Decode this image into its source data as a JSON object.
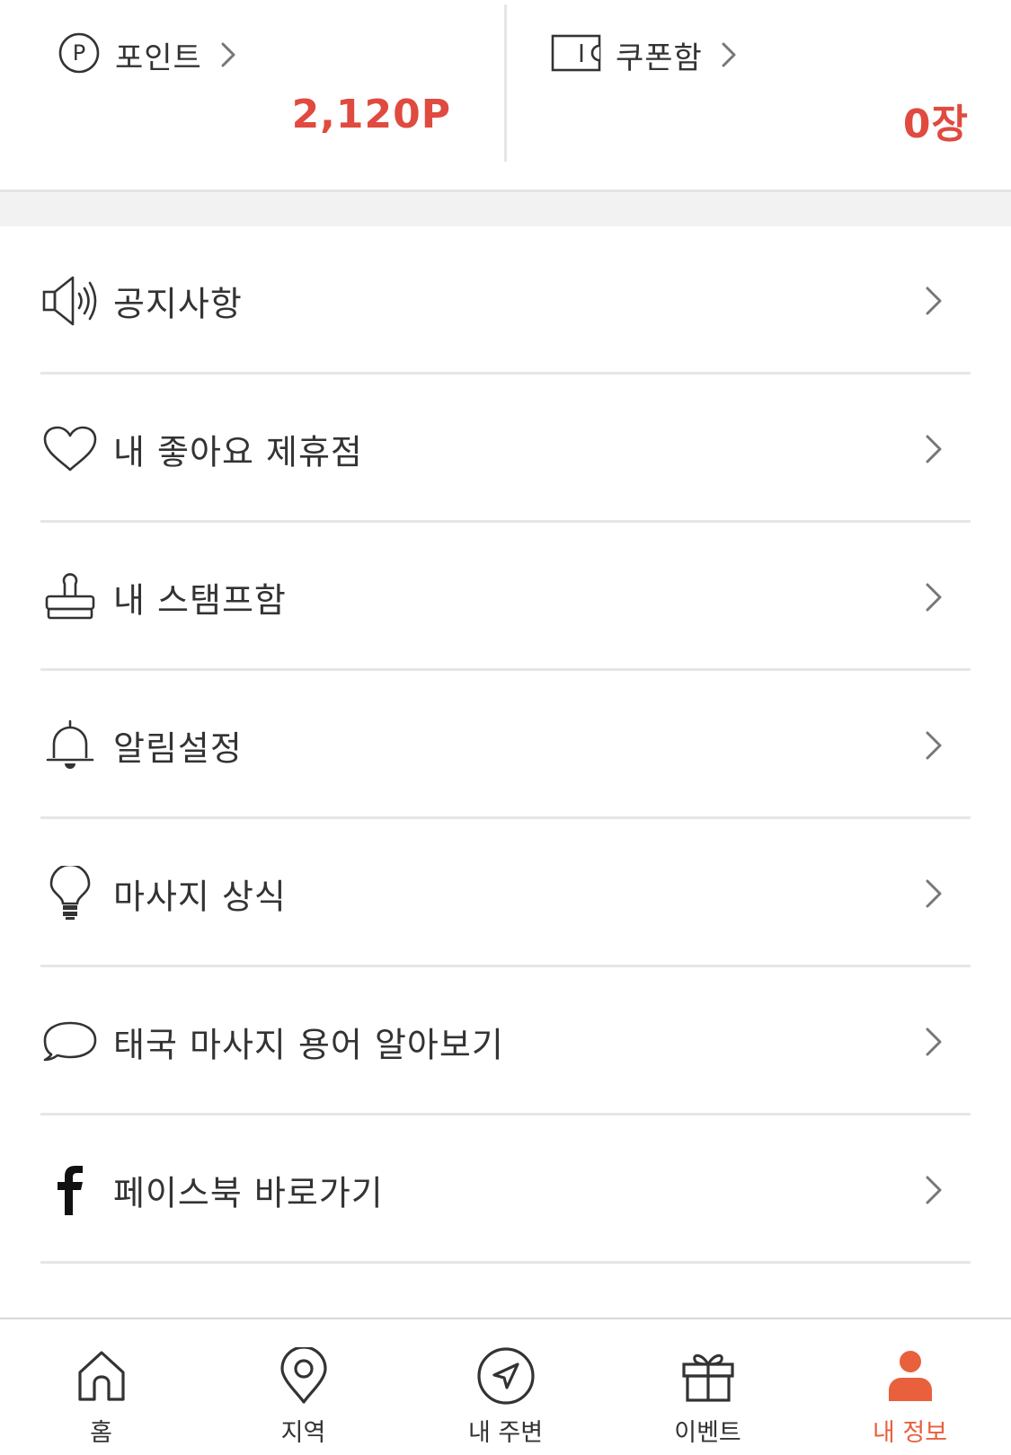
{
  "theme": {
    "accent": "#e04a3f",
    "active_tab": "#e8603c",
    "text": "#333333",
    "divider": "#e6e6e6"
  },
  "summary": {
    "point": {
      "icon": "p-circle-icon",
      "label": "포인트",
      "value": "2,120P"
    },
    "coupon": {
      "icon": "ticket-icon",
      "label": "쿠폰함",
      "value": "0장"
    }
  },
  "menu": {
    "items": [
      {
        "icon": "megaphone-icon",
        "label": "공지사항"
      },
      {
        "icon": "heart-icon",
        "label": "내 좋아요 제휴점"
      },
      {
        "icon": "stamp-icon",
        "label": "내 스탬프함"
      },
      {
        "icon": "bell-icon",
        "label": "알림설정"
      },
      {
        "icon": "lightbulb-icon",
        "label": "마사지 상식"
      },
      {
        "icon": "speech-bubble-icon",
        "label": "태국 마사지 용어 알아보기"
      },
      {
        "icon": "facebook-icon",
        "label": "페이스북 바로가기"
      }
    ]
  },
  "tabbar": {
    "tabs": [
      {
        "icon": "home-icon",
        "label": "홈"
      },
      {
        "icon": "location-pin-icon",
        "label": "지역"
      },
      {
        "icon": "navigation-icon",
        "label": "내 주변"
      },
      {
        "icon": "gift-icon",
        "label": "이벤트"
      },
      {
        "icon": "person-icon",
        "label": "내 정보",
        "active": true
      }
    ]
  }
}
